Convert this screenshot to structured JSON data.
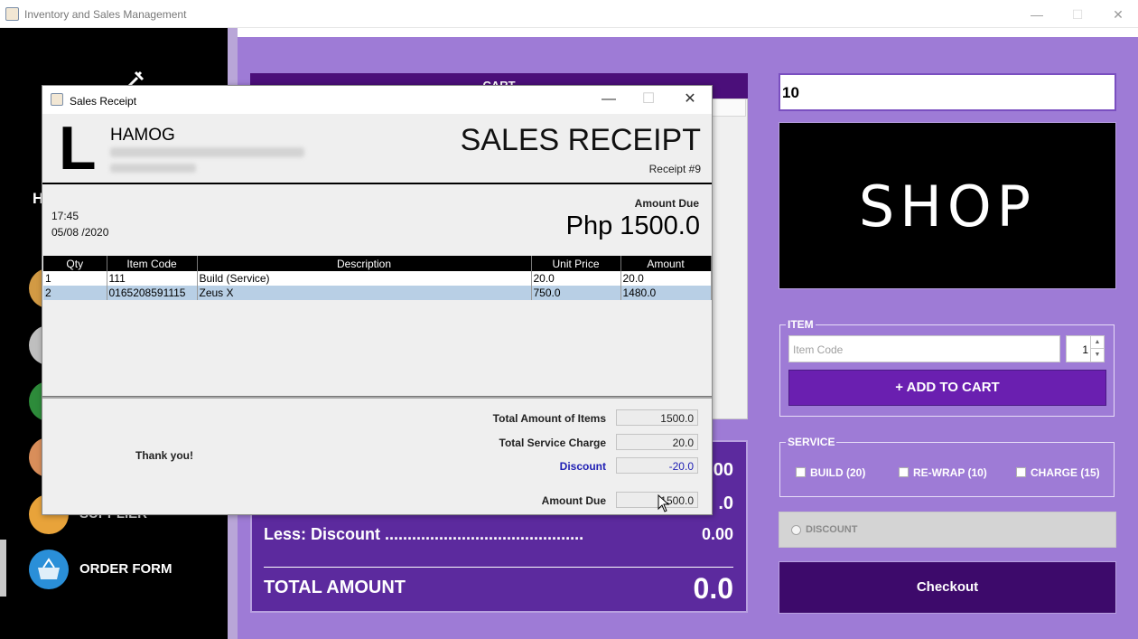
{
  "window": {
    "title": "Inventory and Sales Management",
    "controls": {
      "minimize": "—",
      "maximize": "☐",
      "close": "✕"
    }
  },
  "sidebar": {
    "heading_fragment": "H",
    "items": [
      {
        "label": "SUPPLIER",
        "icon": "truck-icon"
      },
      {
        "label": "ORDER FORM",
        "icon": "basket-icon"
      }
    ]
  },
  "cart": {
    "header": "CART"
  },
  "totals": {
    "row1_val": ".00",
    "row2_val": ".0",
    "discount_label": "Less: Discount ............................................",
    "discount_val": "0.00",
    "total_label": "TOTAL AMOUNT",
    "total_val": "0.0"
  },
  "right_panel": {
    "quantity_value": "10",
    "shop_banner": "SHOP",
    "item_group_title": "ITEM",
    "item_code_placeholder": "Item Code",
    "spinner_value": "1",
    "add_to_cart": "+ ADD TO CART",
    "service_group_title": "SERVICE",
    "services": [
      "BUILD (20)",
      "RE-WRAP (10)",
      "CHARGE (15)"
    ],
    "discount_label": "DISCOUNT",
    "checkout": "Checkout"
  },
  "receipt_dialog": {
    "title": "Sales Receipt",
    "logo_letter": "L",
    "business_name": "HAMOG",
    "heading": "SALES RECEIPT",
    "receipt_no": "Receipt #9",
    "time": "17:45",
    "date": "05/08 /2020",
    "amount_due_label": "Amount Due",
    "amount_due_value": "Php 1500.0",
    "columns": [
      "Qty",
      "Item Code",
      "Description",
      "Unit Price",
      "Amount"
    ],
    "rows": [
      [
        "1",
        "111",
        "Build  (Service)",
        "20.0",
        "20.0"
      ],
      [
        "2",
        "0165208591115",
        "Zeus X",
        "750.0",
        "1480.0"
      ]
    ],
    "thank_you": "Thank you!",
    "summary": {
      "total_items_label": "Total Amount of Items",
      "total_items_value": "1500.0",
      "service_label": "Total Service Charge",
      "service_value": "20.0",
      "discount_label": "Discount",
      "discount_value": "-20.0",
      "amount_due_label": "Amount Due",
      "amount_due_value": "1500.0"
    },
    "colors": {
      "discount_text": "#1f1fb4",
      "selected_row": "#b8cfe5"
    }
  },
  "colors": {
    "purple_bg": "#9e7bd6",
    "dark_purple": "#3d0a6b",
    "button_purple": "#6a1fb0"
  }
}
